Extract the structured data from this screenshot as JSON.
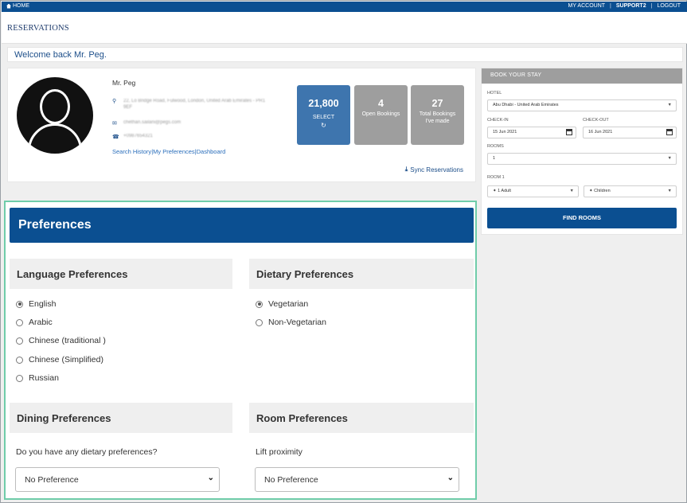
{
  "topbar": {
    "home": "HOME",
    "my_account": "MY ACCOUNT",
    "user": "SUPPORT2",
    "logout": "LOGOUT"
  },
  "header": {
    "logo": "RESERVATIONS"
  },
  "welcome": "Welcome back Mr. Peg.",
  "profile": {
    "name": "Mr. Peg",
    "address": "22, Lo Bridge Road, Fulwood, London, United Arab Emirates - PR1 9EF",
    "email": "chethan.sailani@pegs.com",
    "phone": "+0987654321",
    "links": [
      "Search History",
      "My Preferences",
      "Dashboard"
    ],
    "link_separator": "|",
    "sync_label": "Sync Reservations"
  },
  "stats": [
    {
      "value": "21,800",
      "label": "SELECT",
      "color": "#3e75ae"
    },
    {
      "value": "4",
      "label": "Open Bookings",
      "color": "#9e9e9e"
    },
    {
      "value": "27",
      "label": "Total Bookings I've made",
      "color": "#9e9e9e"
    }
  ],
  "book": {
    "title": "BOOK YOUR STAY",
    "hotel_label": "HOTEL",
    "hotel_value": "Abu Dhabi - United Arab Emirates",
    "checkin_label": "CHECK-IN",
    "checkin_value": "15 Jun 2021",
    "checkout_label": "CHECK-OUT",
    "checkout_value": "16 Jun 2021",
    "rooms_label": "ROOMS",
    "rooms_value": "1",
    "room1_label": "ROOM 1",
    "adults_value": "1 Adult",
    "children_value": "Children",
    "find_button": "FIND ROOMS"
  },
  "preferences": {
    "title": "Preferences",
    "language": {
      "title": "Language Preferences",
      "options": [
        "English",
        "Arabic",
        "Chinese (traditional )",
        "Chinese (Simplified)",
        "Russian"
      ],
      "selected": "English"
    },
    "dietary": {
      "title": "Dietary Preferences",
      "options": [
        "Vegetarian",
        "Non-Vegetarian"
      ],
      "selected": "Vegetarian"
    },
    "dining": {
      "title": "Dining Preferences",
      "question": "Do you have any dietary preferences?",
      "value": "No Preference"
    },
    "room": {
      "title": "Room Preferences",
      "question": "Lift proximity",
      "value": "No Preference"
    }
  },
  "accent_colors": {
    "brand_blue": "#0b4f91",
    "highlight_green": "#6fcca9"
  }
}
